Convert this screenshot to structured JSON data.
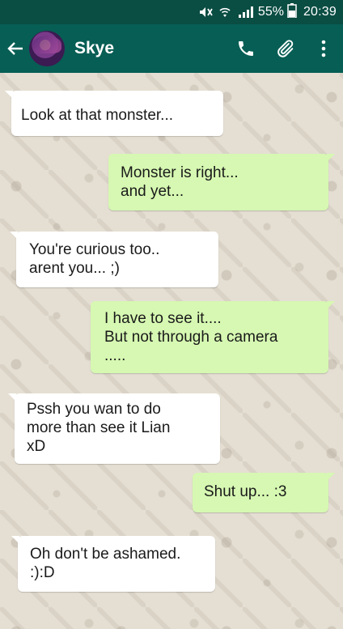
{
  "status_bar": {
    "battery_percent": "55%",
    "time": "20:39",
    "icons": [
      "mute-icon",
      "wifi-icon",
      "signal-icon",
      "battery-icon"
    ]
  },
  "header": {
    "contact_name": "Skye",
    "icons": [
      "back-arrow-icon",
      "avatar",
      "phone-icon",
      "paperclip-icon",
      "more-vert-icon"
    ]
  },
  "messages": [
    {
      "direction": "incoming",
      "lines": [
        "Look at that monster..."
      ]
    },
    {
      "direction": "outgoing",
      "lines": [
        "Monster is right...",
        "and yet..."
      ]
    },
    {
      "direction": "incoming",
      "lines": [
        "You're curious too..",
        "arent you... ;)"
      ]
    },
    {
      "direction": "outgoing",
      "lines": [
        "I have to see it....",
        "But not through a camera",
        "....."
      ]
    },
    {
      "direction": "incoming",
      "lines": [
        "Pssh you wan to do",
        "more than see it Lian",
        "xD"
      ]
    },
    {
      "direction": "outgoing",
      "lines": [
        "Shut up... :3"
      ]
    },
    {
      "direction": "incoming",
      "lines": [
        "Oh don't be ashamed.",
        ":):D"
      ]
    }
  ],
  "colors": {
    "status_bar": "#0a4d43",
    "header": "#075e54",
    "incoming_bubble": "#ffffff",
    "outgoing_bubble": "#d6f8b2",
    "chat_background": "#e5dfd3"
  }
}
